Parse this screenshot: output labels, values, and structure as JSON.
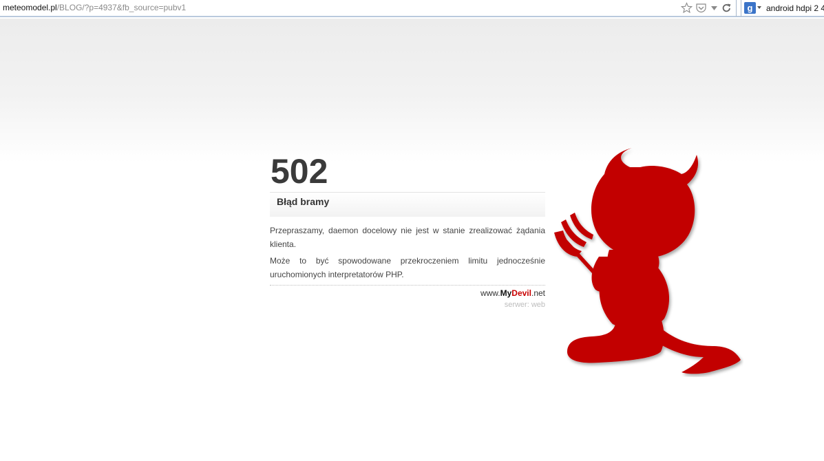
{
  "browser": {
    "url_domain": "meteomodel.pl",
    "url_path": "/BLOG/?p=4937&fb_source=pubv1",
    "search_engine_badge": "g",
    "search_query": "android hdpi 2 4",
    "icons": [
      "star-icon",
      "pocket-icon",
      "dropdown-arrow-icon",
      "reload-icon",
      "google-icon"
    ]
  },
  "error": {
    "code": "502",
    "title": "Błąd bramy",
    "message_1": "Przepraszamy, daemon docelowy nie jest w stanie zrealizować żądania klienta.",
    "message_2": "Może to być spowodowane przekroczeniem limitu jednocześnie uruchomionych interpretatorów PHP."
  },
  "footer": {
    "brand_prefix": "www.",
    "brand_my": "My",
    "brand_devil": "Devil",
    "brand_suffix": ".net",
    "server": "serwer: web"
  },
  "colors": {
    "brand_red": "#c80000",
    "devil_red": "#c20000",
    "code_text": "#3a3a3a"
  },
  "illustration": "bsd-daemon-silhouette"
}
